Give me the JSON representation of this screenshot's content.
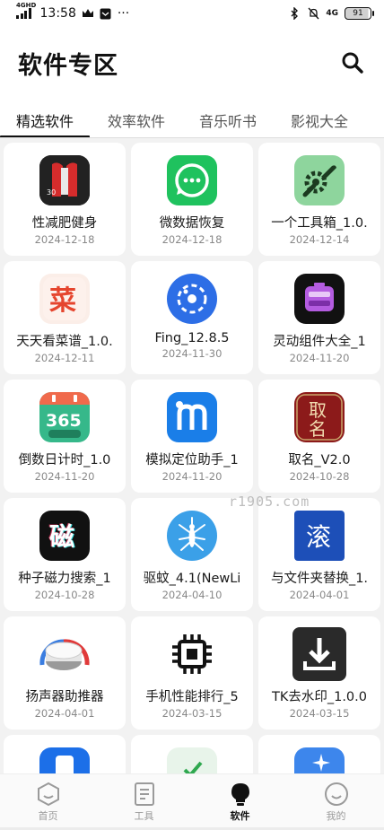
{
  "status_bar": {
    "network": "4GHD",
    "time": "13:58",
    "more": "···",
    "net_type_right": "4G",
    "battery": "91"
  },
  "header": {
    "title": "软件专区"
  },
  "tabs": [
    {
      "label": "精选软件",
      "active": true
    },
    {
      "label": "效率软件",
      "active": false
    },
    {
      "label": "音乐听书",
      "active": false
    },
    {
      "label": "影视大全",
      "active": false
    }
  ],
  "apps": [
    {
      "name": "性减肥健身",
      "date": "2024-12-18",
      "icon": "fitness-icon"
    },
    {
      "name": "微数据恢复",
      "date": "2024-12-18",
      "icon": "chat-recovery-icon"
    },
    {
      "name": "一个工具箱_1.0.",
      "date": "2024-12-14",
      "icon": "wrench-gear-icon"
    },
    {
      "name": "天天看菜谱_1.0.",
      "date": "2024-12-11",
      "icon": "recipe-icon"
    },
    {
      "name": "Fing_12.8.5",
      "date": "2024-11-30",
      "icon": "fing-icon"
    },
    {
      "name": "灵动组件大全_1",
      "date": "2024-11-20",
      "icon": "widget-icon"
    },
    {
      "name": "倒数日计时_1.0",
      "date": "2024-11-20",
      "icon": "calendar-365-icon"
    },
    {
      "name": "模拟定位助手_1",
      "date": "2024-11-20",
      "icon": "location-m-icon"
    },
    {
      "name": "取名_V2.0",
      "date": "2024-10-28",
      "icon": "naming-icon"
    },
    {
      "name": "种子磁力搜索_1",
      "date": "2024-10-28",
      "icon": "magnet-icon"
    },
    {
      "name": "驱蚊_4.1(NewLi",
      "date": "2024-04-10",
      "icon": "mosquito-icon"
    },
    {
      "name": "与文件夹替换_1.",
      "date": "2024-04-01",
      "icon": "folder-replace-icon"
    },
    {
      "name": "扬声器助推器",
      "date": "2024-04-01",
      "icon": "speaker-knob-icon"
    },
    {
      "name": "手机性能排行_5",
      "date": "2024-03-15",
      "icon": "chip-icon"
    },
    {
      "name": "TK去水印_1.0.0",
      "date": "2024-03-15",
      "icon": "download-icon"
    }
  ],
  "watermark": "r1905.com",
  "bottom_nav": [
    {
      "label": "首页",
      "icon": "home-hexagon-icon",
      "active": false
    },
    {
      "label": "工具",
      "icon": "tools-doc-icon",
      "active": false
    },
    {
      "label": "软件",
      "icon": "lightbulb-icon",
      "active": true
    },
    {
      "label": "我的",
      "icon": "profile-smile-icon",
      "active": false
    }
  ],
  "colors": {
    "background": "#f2f2f2",
    "card": "#ffffff",
    "text_primary": "#1a1a1a",
    "text_secondary": "#888888",
    "active": "#111111"
  }
}
